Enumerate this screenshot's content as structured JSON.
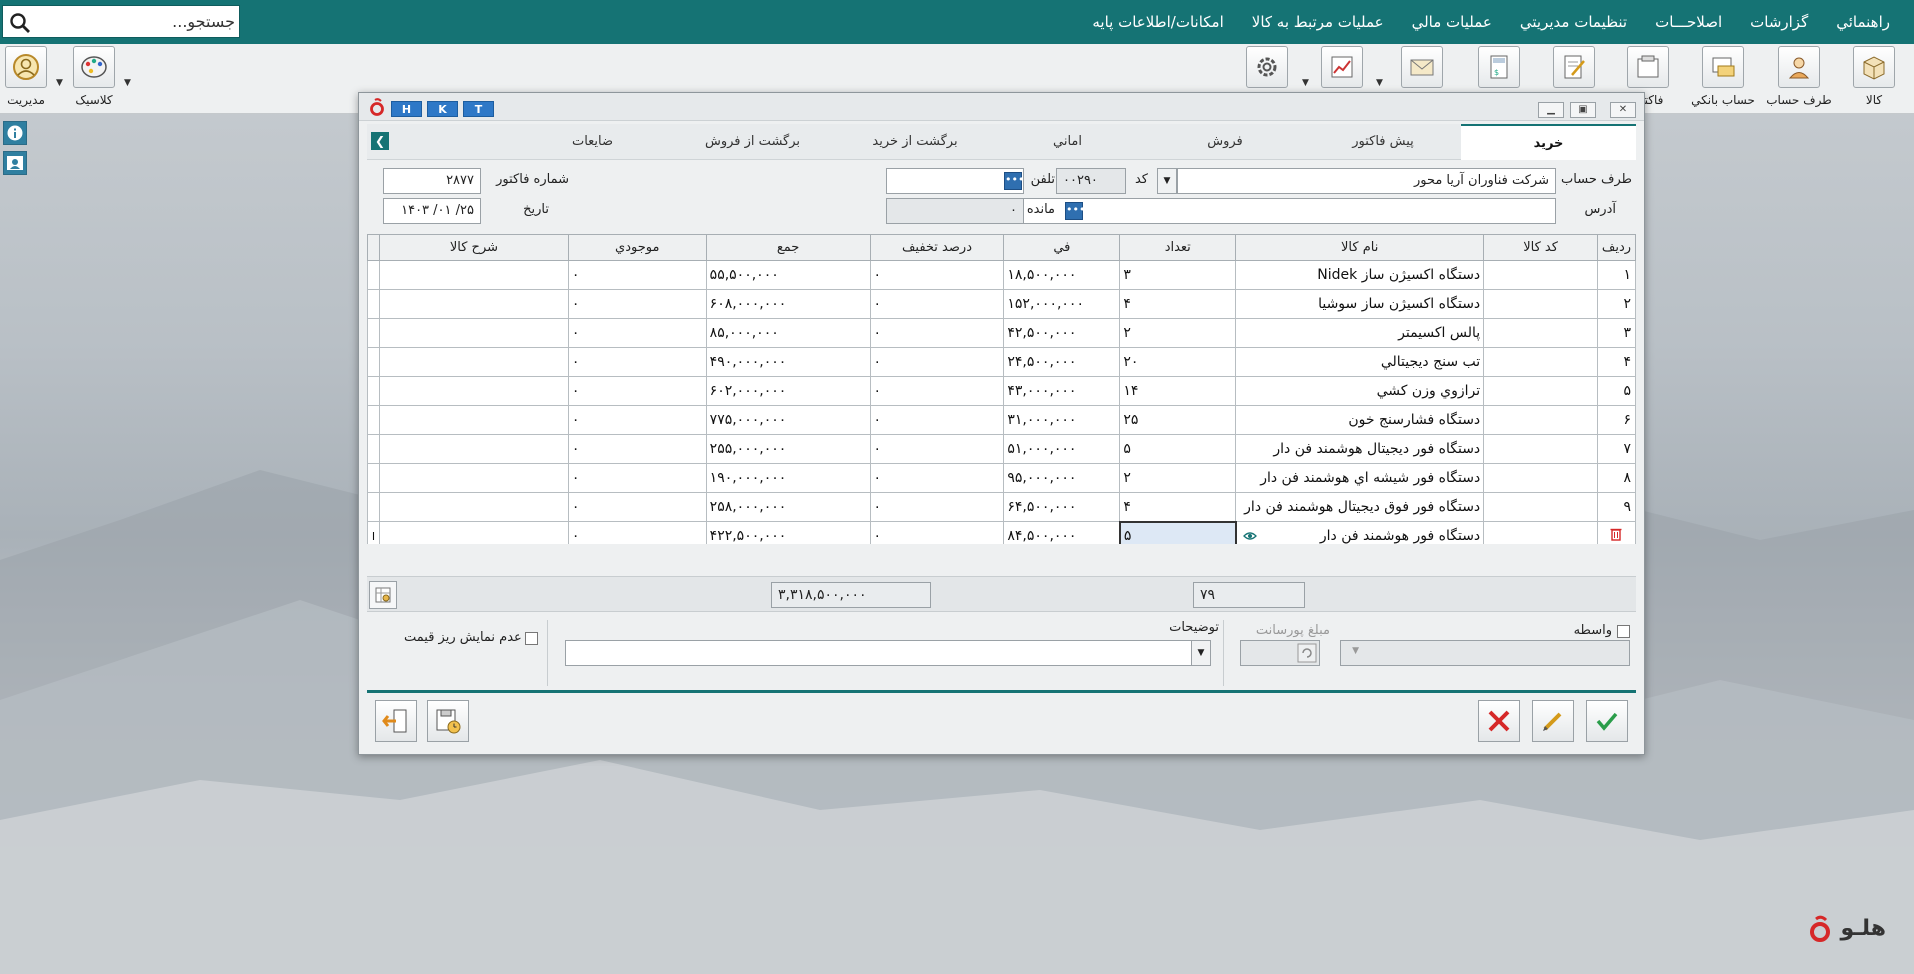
{
  "search": {
    "placeholder": "جستجو..."
  },
  "menu": [
    "امکانات/اطلاعات پايه",
    "عمليات مرتبط به کالا",
    "عمليات مالي",
    "تنظيمات مديريتي",
    "اصلاحـــات",
    "گزارشات",
    "راهنمائي"
  ],
  "toolbar": {
    "right": [
      "کالا",
      "طرف حساب",
      "حساب بانکي",
      "فاکتور"
    ],
    "left": [
      "مديريت",
      "کلاسيک"
    ]
  },
  "dialog": {
    "hk_buttons": [
      "H",
      "K",
      "T"
    ],
    "tabs": [
      "خريد",
      "پيش فاکتور",
      "فروش",
      "اماني",
      "برگشت از خريد",
      "برگشت از فروش",
      "ضايعات"
    ],
    "active_tab": "خريد",
    "form": {
      "account_label": "طرف حساب",
      "account_value": "شرکت فناوران آريا محور",
      "code_label": "کد",
      "code_value": "۰۰۲۹۰",
      "phone_label": "تلفن",
      "phone_value": "",
      "invoice_no_label": "شماره فاکتور",
      "invoice_no_value": "۲۸۷۷",
      "address_label": "آدرس",
      "address_value": "",
      "balance_label": "مانده",
      "balance_value": "۰",
      "date_label": "تاريخ",
      "date_value": "۱۴۰۳ /۰۱ /۲۵"
    },
    "table": {
      "headers": [
        "رديف",
        "کد کالا",
        "نام کالا",
        "تعداد",
        "في",
        "درصد تخفيف",
        "جمع",
        "موجودي",
        "شرح کالا"
      ],
      "rows": [
        {
          "rn": "۱",
          "code": "",
          "name": "دستگاه اکسيژن ساز Nidek",
          "qty": "۳",
          "price": "۱۸,۵۰۰,۰۰۰",
          "disc": "۰",
          "total": "۵۵,۵۰۰,۰۰۰",
          "stock": "۰",
          "desc": ""
        },
        {
          "rn": "۲",
          "code": "",
          "name": "دستگاه اکسيژن ساز سوشيا",
          "qty": "۴",
          "price": "۱۵۲,۰۰۰,۰۰۰",
          "disc": "۰",
          "total": "۶۰۸,۰۰۰,۰۰۰",
          "stock": "۰",
          "desc": ""
        },
        {
          "rn": "۳",
          "code": "",
          "name": "پالس اکسيمتر",
          "qty": "۲",
          "price": "۴۲,۵۰۰,۰۰۰",
          "disc": "۰",
          "total": "۸۵,۰۰۰,۰۰۰",
          "stock": "۰",
          "desc": ""
        },
        {
          "rn": "۴",
          "code": "",
          "name": "تب سنج ديجيتالي",
          "qty": "۲۰",
          "price": "۲۴,۵۰۰,۰۰۰",
          "disc": "۰",
          "total": "۴۹۰,۰۰۰,۰۰۰",
          "stock": "۰",
          "desc": ""
        },
        {
          "rn": "۵",
          "code": "",
          "name": "ترازوي وزن کشي",
          "qty": "۱۴",
          "price": "۴۳,۰۰۰,۰۰۰",
          "disc": "۰",
          "total": "۶۰۲,۰۰۰,۰۰۰",
          "stock": "۰",
          "desc": ""
        },
        {
          "rn": "۶",
          "code": "",
          "name": "دستگاه فشارسنج خون",
          "qty": "۲۵",
          "price": "۳۱,۰۰۰,۰۰۰",
          "disc": "۰",
          "total": "۷۷۵,۰۰۰,۰۰۰",
          "stock": "۰",
          "desc": ""
        },
        {
          "rn": "۷",
          "code": "",
          "name": "دستگاه فور ديجيتال هوشمند فن دار",
          "qty": "۵",
          "price": "۵۱,۰۰۰,۰۰۰",
          "disc": "۰",
          "total": "۲۵۵,۰۰۰,۰۰۰",
          "stock": "۰",
          "desc": ""
        },
        {
          "rn": "۸",
          "code": "",
          "name": "دستگاه فور شيشه اي هوشمند فن دار",
          "qty": "۲",
          "price": "۹۵,۰۰۰,۰۰۰",
          "disc": "۰",
          "total": "۱۹۰,۰۰۰,۰۰۰",
          "stock": "۰",
          "desc": ""
        },
        {
          "rn": "۹",
          "code": "",
          "name": "دستگاه فور فوق ديجيتال هوشمند فن دار",
          "qty": "۴",
          "price": "۶۴,۵۰۰,۰۰۰",
          "disc": "۰",
          "total": "۲۵۸,۰۰۰,۰۰۰",
          "stock": "۰",
          "desc": ""
        },
        {
          "rn": "",
          "code": "",
          "name": "دستگاه فور هوشمند فن دار",
          "qty": "۵",
          "price": "۸۴,۵۰۰,۰۰۰",
          "disc": "۰",
          "total": "۴۲۲,۵۰۰,۰۰۰",
          "stock": "۰",
          "desc": ""
        }
      ]
    },
    "totals": {
      "qty_sum": "۷۹",
      "amount_sum": "۳,۳۱۸,۵۰۰,۰۰۰"
    },
    "bottom": {
      "intermediary_label": "واسطه",
      "commission_label": "مبلغ پورسانت",
      "notes_label": "توضيحات",
      "notes_value": "+",
      "hide_price_label": "عدم نمايش ريز قيمت"
    }
  },
  "brand": {
    "text": "هلـو"
  },
  "colors": {
    "primary": "#157374",
    "accent": "#2e78c7",
    "danger": "#d62828",
    "ok": "#2a9d4a"
  }
}
